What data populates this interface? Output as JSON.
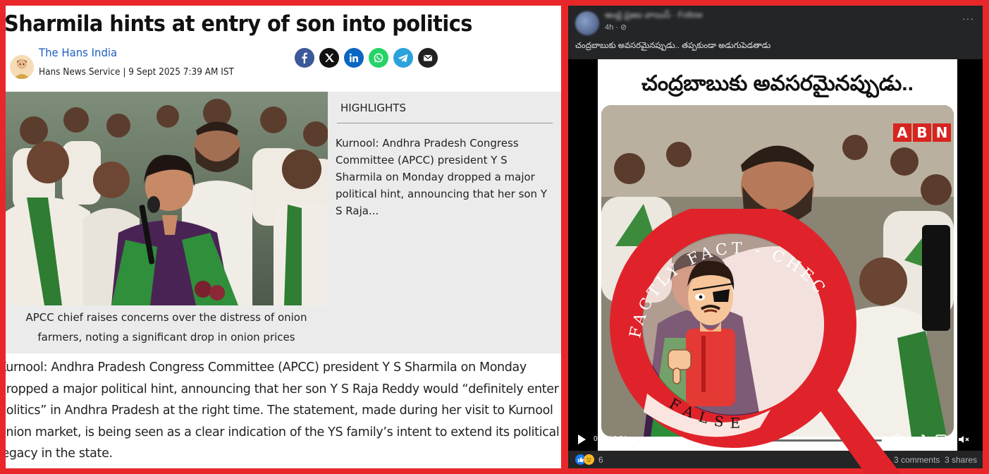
{
  "article": {
    "headline": "Sharmila hints at entry of son into politics",
    "author": "The Hans India",
    "byline": "Hans News Service | 9 Sept 2025 7:39 AM IST",
    "share_icons": [
      "facebook-icon",
      "x-icon",
      "linkedin-icon",
      "whatsapp-icon",
      "telegram-icon",
      "email-icon"
    ],
    "caption": "APCC chief raises concerns over the distress of onion farmers, noting a significant drop in onion prices",
    "highlights_title": "HIGHLIGHTS",
    "highlights_text": "Kurnool: Andhra Pradesh Congress Committee (APCC) president Y S Sharmila on Monday dropped a major political hint, announcing that her son Y S Raja...",
    "body_lines": [
      "Kurnool: Andhra Pradesh Congress Committee (APCC) president Y S Sharmila on Monday",
      "dropped a major political hint, announcing that her son Y S Raja Reddy would “definitely enter",
      "politics” in Andhra Pradesh at the right time. The statement, made during her visit to Kurnool",
      "onion market, is being seen as a clear indication of the YS family’s intent to extend its political",
      "legacy in the state."
    ]
  },
  "post": {
    "name_blurred": "ఆంధ్ర ప్రజల వాయిస్ · Follow",
    "time": "4h · ⊘",
    "more": "···",
    "text": "చంద్రబాబుకు అవసరమైనప్పుడు.. తప్పకుండా అడుగుపెడతాడు",
    "video_title": "చంద్రబాబుకు అవసరమైనప్పుడు..",
    "channel_logo": [
      "A",
      "B",
      "N"
    ],
    "time_display": "0:02 / 0:24",
    "progress": 0.5,
    "reaction_count": "6",
    "comments": "3 comments",
    "shares": "3 shares"
  },
  "stamp": {
    "top_text": "FACTLY FACT - CHECK",
    "bottom_text": "FALSE"
  },
  "colors": {
    "border_red": "#e8272a",
    "link_blue": "#1f5fbf",
    "facebook": "#3b5998",
    "x": "#111111",
    "linkedin": "#0a66c2",
    "whatsapp": "#25d366",
    "telegram": "#2aa3dc",
    "email": "#222222",
    "abn_red": "#d8231f"
  }
}
